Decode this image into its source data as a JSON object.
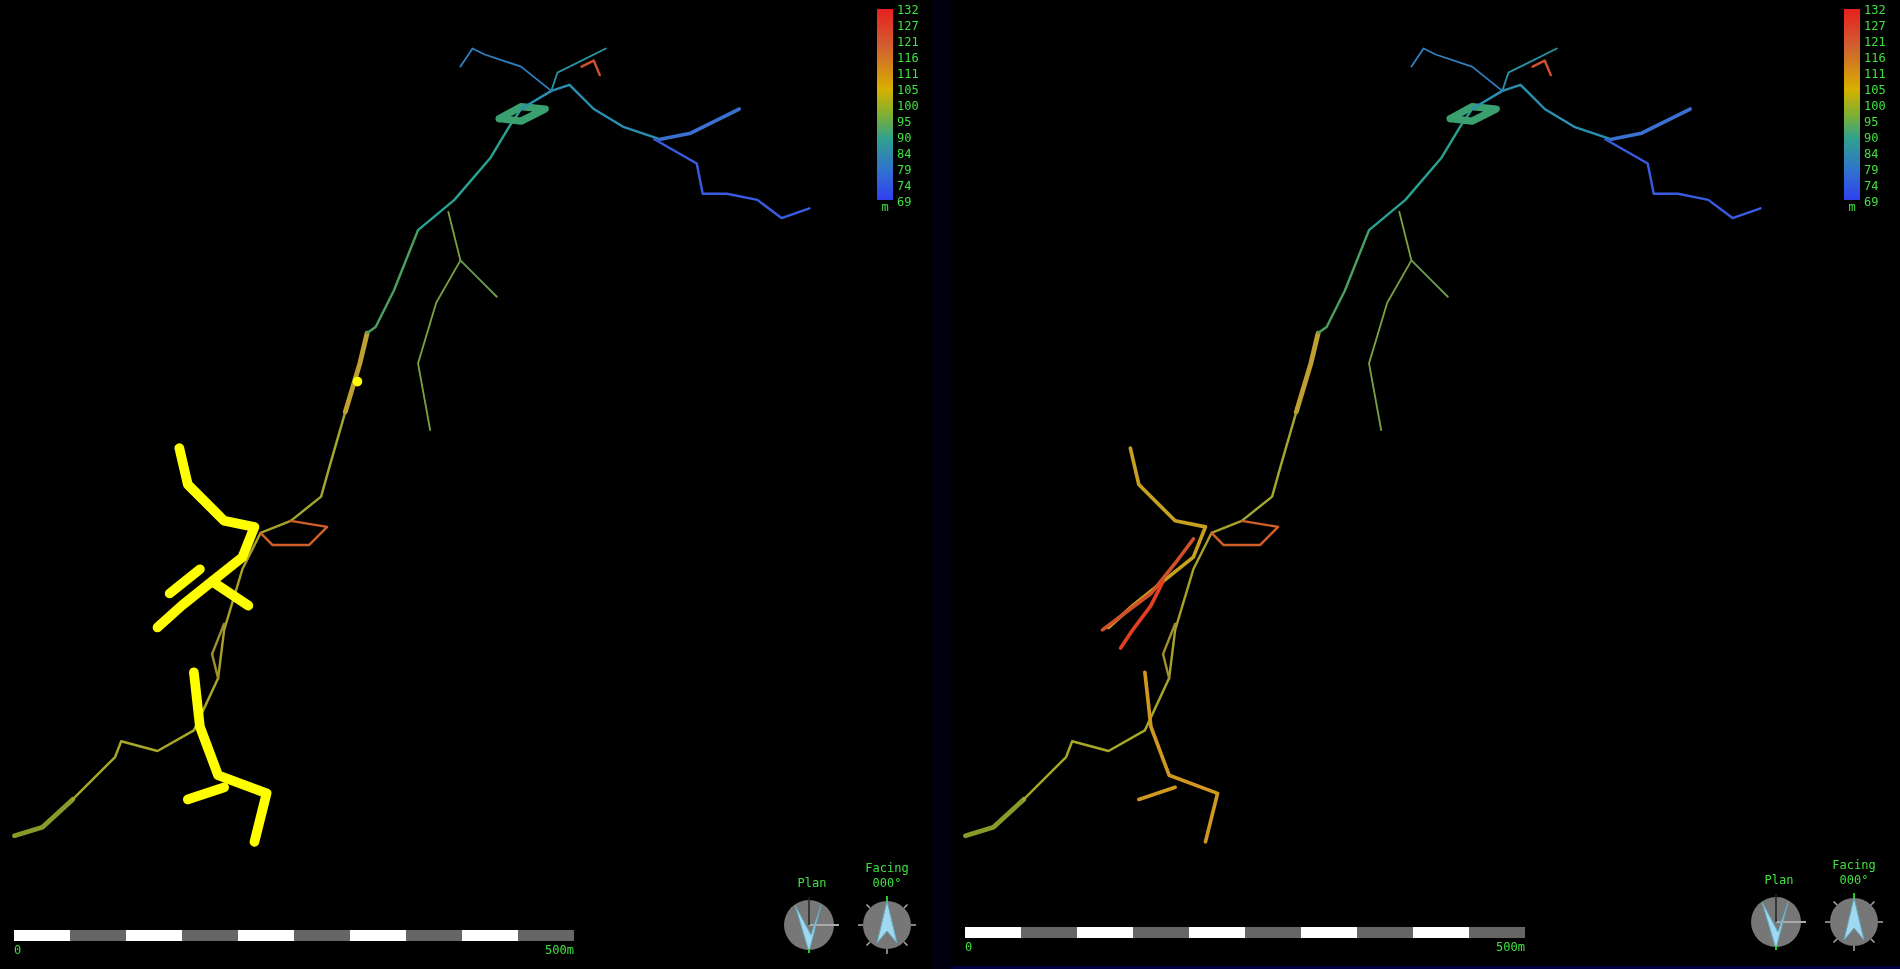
{
  "panels": [
    {
      "selection_highlighted": true,
      "legend": {
        "labels": [
          "132",
          "127",
          "121",
          "116",
          "111",
          "105",
          "100",
          "95",
          "90",
          "84",
          "79",
          "74",
          "69"
        ],
        "unit": "m"
      },
      "plan": {
        "label": "Plan"
      },
      "facing": {
        "label": "Facing",
        "bearing": "000°"
      },
      "scale": {
        "start": "0",
        "end": "500m"
      }
    },
    {
      "selection_highlighted": false,
      "legend": {
        "labels": [
          "132",
          "127",
          "121",
          "116",
          "111",
          "105",
          "100",
          "95",
          "90",
          "84",
          "79",
          "74",
          "69"
        ],
        "unit": "m"
      },
      "plan": {
        "label": "Plan"
      },
      "facing": {
        "label": "Facing",
        "bearing": "000°"
      },
      "scale": {
        "start": "0",
        "end": "500m"
      }
    }
  ]
}
